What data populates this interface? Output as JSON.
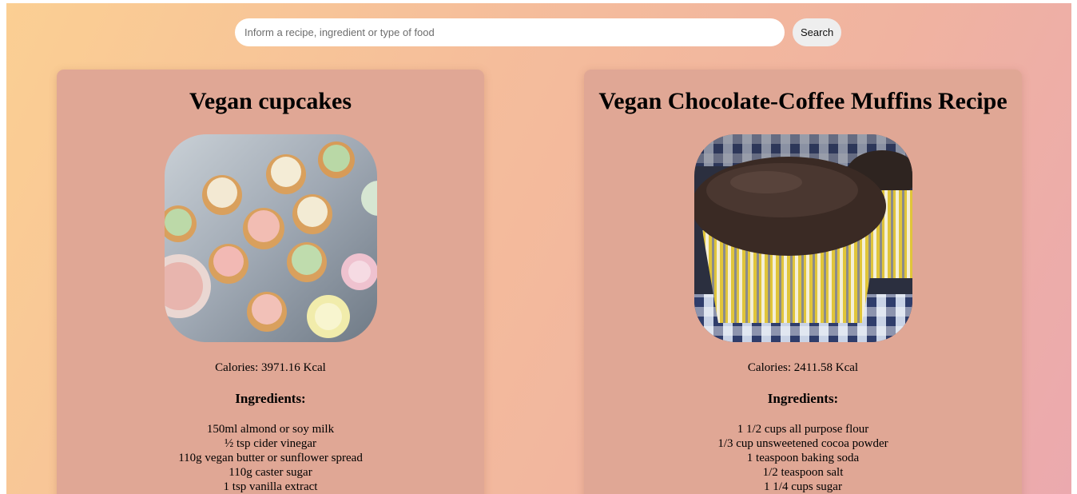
{
  "search": {
    "placeholder": "Inform a recipe, ingredient or type of food",
    "button_label": "Search"
  },
  "recipes": [
    {
      "title": "Vegan cupcakes",
      "image": "cupcakes-photo",
      "calories": "Calories: 3971.16 Kcal",
      "ingredients_heading": "Ingredients:",
      "ingredients": [
        "150ml almond or soy milk",
        "½ tsp cider vinegar",
        "110g vegan butter or sunflower spread",
        "110g caster sugar",
        "1 tsp vanilla extract"
      ]
    },
    {
      "title": "Vegan Chocolate-Coffee Muffins Recipe",
      "image": "chocolate-muffin-photo",
      "calories": "Calories: 2411.58 Kcal",
      "ingredients_heading": "Ingredients:",
      "ingredients": [
        "1 1/2 cups all purpose flour",
        "1/3 cup unsweetened cocoa powder",
        "1 teaspoon baking soda",
        "1/2 teaspoon salt",
        "1 1/4 cups sugar"
      ]
    }
  ]
}
